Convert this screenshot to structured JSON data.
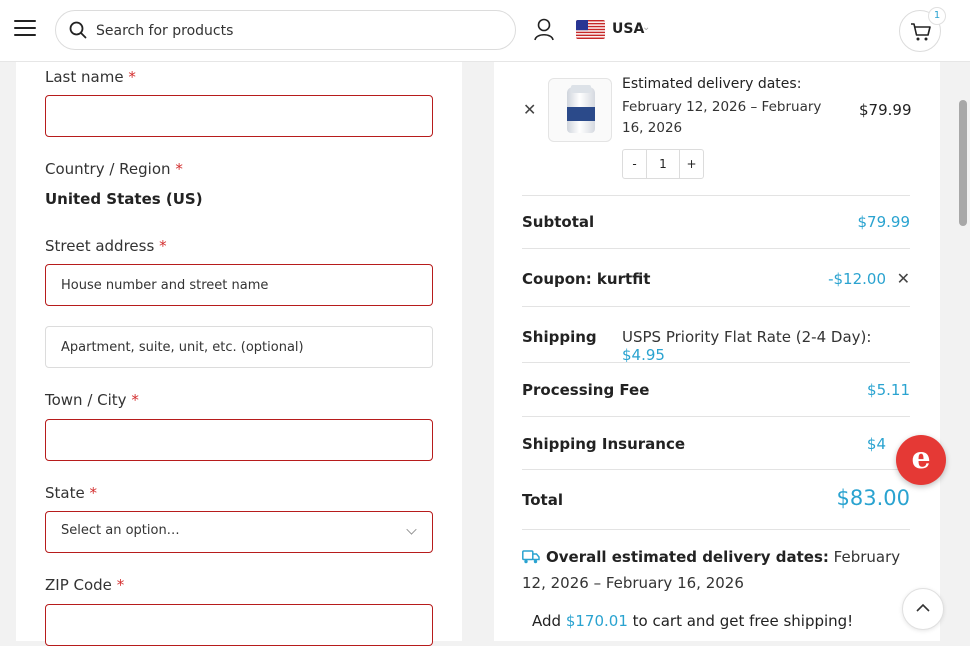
{
  "header": {
    "search_placeholder": "Search for products",
    "country": "USA",
    "cart_count": "1"
  },
  "form": {
    "last_name_label": "Last name",
    "required_mark": "*",
    "country_label": "Country / Region",
    "country_value": "United States (US)",
    "street_label": "Street address",
    "street_placeholder": "House number and street name",
    "apt_placeholder": "Apartment, suite, unit, etc. (optional)",
    "city_label": "Town / City",
    "state_label": "State",
    "state_select_value": "Select an option…",
    "zip_label": "ZIP Code"
  },
  "order": {
    "item": {
      "est_title": "Estimated delivery dates:",
      "est_dates": "February 12, 2026 – February 16, 2026",
      "price": "$79.99",
      "quantity": "1",
      "minus": "-",
      "plus": "+"
    },
    "subtotal_label": "Subtotal",
    "subtotal_value": "$79.99",
    "coupon_label": "Coupon: kurtfit",
    "coupon_value": "-$12.00",
    "shipping_label": "Shipping",
    "shipping_method": "USPS Priority Flat Rate (2-4 Day):",
    "shipping_value": "$4.95",
    "processing_label": "Processing Fee",
    "processing_value": "$5.11",
    "insurance_label": "Shipping Insurance",
    "insurance_value": "$4",
    "total_label": "Total",
    "total_value": "$83.00",
    "overall_label": "Overall estimated delivery dates:",
    "overall_dates": "February 12, 2026 – February 16, 2026",
    "free_ship_pre": "Add",
    "free_ship_amount": "$170.01",
    "free_ship_post": "to cart and get free shipping!"
  },
  "colors": {
    "accent": "#2aa3d0",
    "error_border": "#b71c1c",
    "chat_button": "#e53935"
  }
}
